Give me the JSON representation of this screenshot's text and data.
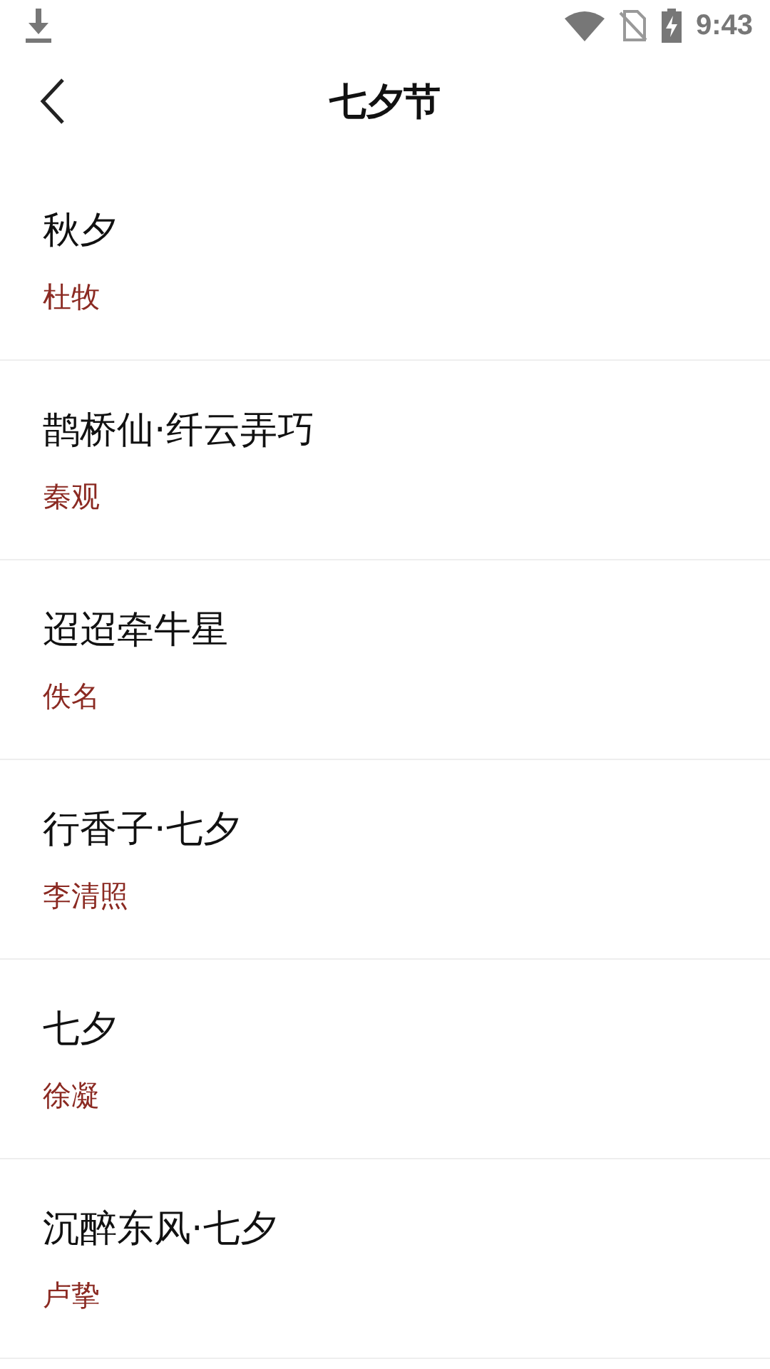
{
  "status_bar": {
    "time": "9:43"
  },
  "header": {
    "title": "七夕节"
  },
  "poems": [
    {
      "title": "秋夕",
      "author": "杜牧"
    },
    {
      "title": "鹊桥仙·纤云弄巧",
      "author": "秦观"
    },
    {
      "title": "迢迢牵牛星",
      "author": "佚名"
    },
    {
      "title": "行香子·七夕",
      "author": "李清照"
    },
    {
      "title": "七夕",
      "author": "徐凝"
    },
    {
      "title": "沉醉东风·七夕",
      "author": "卢挚"
    }
  ]
}
